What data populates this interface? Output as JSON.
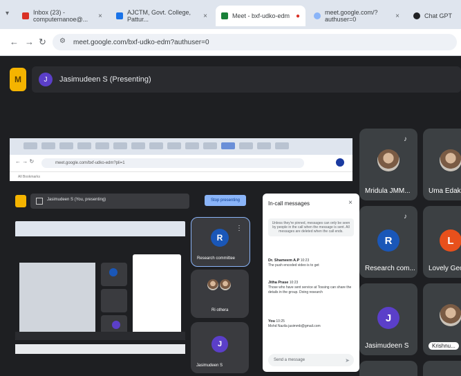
{
  "browser": {
    "tabs": [
      {
        "label": "Inbox (23) - computernanoe@...",
        "active": false,
        "color": "#d93025"
      },
      {
        "label": "AJCTM, Govt. College, Pattur...",
        "active": false,
        "color": "#1a73e8"
      },
      {
        "label": "Meet - bxf-udko-edm",
        "active": true,
        "color": "#188038"
      },
      {
        "label": "meet.google.com/?authuser=0",
        "active": false,
        "color": "#8ab4f8"
      },
      {
        "label": "Chat GPT",
        "active": false,
        "color": "#202124"
      }
    ],
    "url": "meet.google.com/bxf-udko-edm?authuser=0"
  },
  "meet": {
    "presenting_label": "Jasimudeen S (Presenting)",
    "presenter_initial": "J",
    "logo_glyph": "M"
  },
  "shared": {
    "inner_url": "meet.google.com/bxf-udko-edm?pli=1",
    "bookmarks": "All Bookmarks",
    "present_label": "Jasimudeen S (You, presenting)",
    "stop_button": "Stop presenting",
    "tiles": [
      {
        "initial": "R",
        "name": "Research committee",
        "color": "#1a57b8"
      },
      {
        "initial": "",
        "name": "Ri othera",
        "color": "#5f6368"
      },
      {
        "initial": "J",
        "name": "Jasimudeen S",
        "color": "#5b3fc9"
      }
    ],
    "chat": {
      "title": "In-call messages",
      "note": "Unless they're pinned, messages can only be seen by people in the call when the message is sent. All messages are deleted when the call ends.",
      "messages": [
        {
          "sender": "Dr. Shameem A.P",
          "time": "10:23",
          "text": "The push encoded video is to get"
        },
        {
          "sender": "Jitha Prase",
          "time": "10:23",
          "text": "Those who have sent service at Tossing can share the details in the group. Doing research"
        },
        {
          "sender": "You",
          "time": "10:25",
          "text": "Mohd Nazila jasimmb@gmail.com"
        }
      ],
      "input_placeholder": "Send a message"
    }
  },
  "grid": [
    {
      "name": "Mridula JMM...",
      "kind": "photo",
      "initial": ""
    },
    {
      "name": "Uma Edako...",
      "kind": "photo",
      "initial": ""
    },
    {
      "name": "Research com...",
      "kind": "initial",
      "initial": "R",
      "color": "#1a57b8"
    },
    {
      "name": "Lovely Geo...",
      "kind": "initial",
      "initial": "L",
      "color": "#e8501c"
    },
    {
      "name": "Jasimudeen S",
      "kind": "initial",
      "initial": "J",
      "color": "#5b3fc9"
    },
    {
      "name": "Krishnu...",
      "kind": "photo",
      "initial": ""
    }
  ]
}
